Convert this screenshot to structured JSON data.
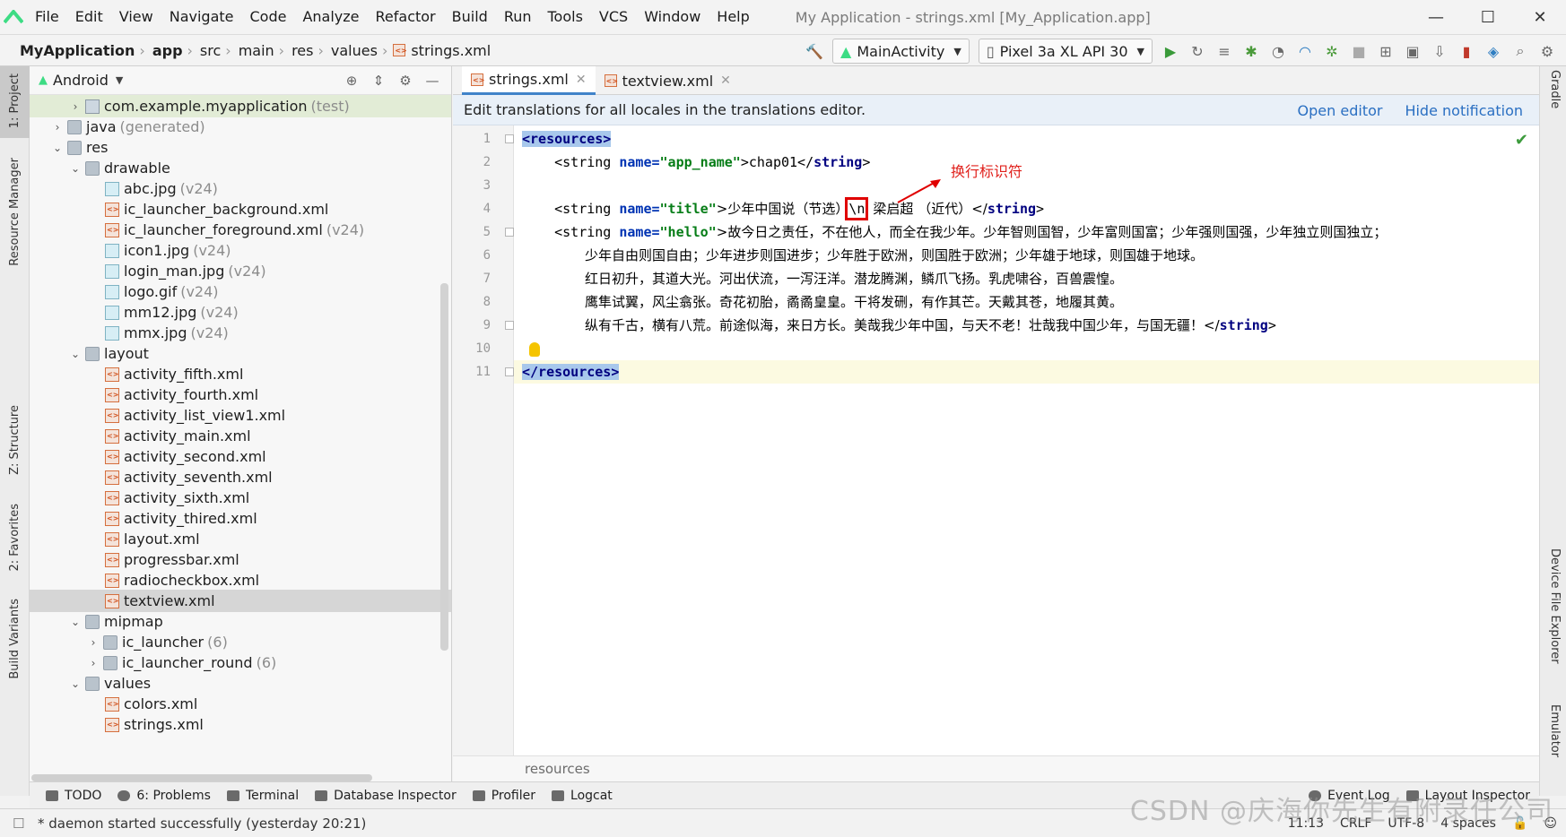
{
  "window": {
    "title": "My Application - strings.xml [My_Application.app]",
    "menu": [
      "File",
      "Edit",
      "View",
      "Navigate",
      "Code",
      "Analyze",
      "Refactor",
      "Build",
      "Run",
      "Tools",
      "VCS",
      "Window",
      "Help"
    ]
  },
  "navbar": {
    "breadcrumbs": [
      "MyApplication",
      "app",
      "src",
      "main",
      "res",
      "values",
      "strings.xml"
    ],
    "run_config": "MainActivity",
    "device": "Pixel 3a XL API 30"
  },
  "left_strip": {
    "tabs": [
      "1: Project",
      "Resource Manager",
      "Z: Structure",
      "2: Favorites",
      "Build Variants"
    ]
  },
  "right_strip": {
    "tabs": [
      "Gradle",
      "Device File Explorer",
      "Emulator"
    ]
  },
  "project": {
    "view": "Android",
    "tree": [
      {
        "label": "com.example.myapplication",
        "suffix": "(test)"
      },
      {
        "label": "java",
        "suffix": "(generated)"
      },
      {
        "label": "res",
        "suffix": ""
      },
      {
        "label": "drawable",
        "suffix": ""
      },
      {
        "label": "abc.jpg",
        "suffix": "(v24)"
      },
      {
        "label": "ic_launcher_background.xml",
        "suffix": ""
      },
      {
        "label": "ic_launcher_foreground.xml",
        "suffix": "(v24)"
      },
      {
        "label": "icon1.jpg",
        "suffix": "(v24)"
      },
      {
        "label": "login_man.jpg",
        "suffix": "(v24)"
      },
      {
        "label": "logo.gif",
        "suffix": "(v24)"
      },
      {
        "label": "mm12.jpg",
        "suffix": "(v24)"
      },
      {
        "label": "mmx.jpg",
        "suffix": "(v24)"
      },
      {
        "label": "layout",
        "suffix": ""
      },
      {
        "label": "activity_fifth.xml",
        "suffix": ""
      },
      {
        "label": "activity_fourth.xml",
        "suffix": ""
      },
      {
        "label": "activity_list_view1.xml",
        "suffix": ""
      },
      {
        "label": "activity_main.xml",
        "suffix": ""
      },
      {
        "label": "activity_second.xml",
        "suffix": ""
      },
      {
        "label": "activity_seventh.xml",
        "suffix": ""
      },
      {
        "label": "activity_sixth.xml",
        "suffix": ""
      },
      {
        "label": "activity_thired.xml",
        "suffix": ""
      },
      {
        "label": "layout.xml",
        "suffix": ""
      },
      {
        "label": "progressbar.xml",
        "suffix": ""
      },
      {
        "label": "radiocheckbox.xml",
        "suffix": ""
      },
      {
        "label": "textview.xml",
        "suffix": ""
      },
      {
        "label": "mipmap",
        "suffix": ""
      },
      {
        "label": "ic_launcher",
        "suffix": "(6)"
      },
      {
        "label": "ic_launcher_round",
        "suffix": "(6)"
      },
      {
        "label": "values",
        "suffix": ""
      },
      {
        "label": "colors.xml",
        "suffix": ""
      },
      {
        "label": "strings.xml",
        "suffix": ""
      }
    ]
  },
  "editor": {
    "tabs": [
      "strings.xml",
      "textview.xml"
    ],
    "notification": "Edit translations for all locales in the translations editor.",
    "notif_open": "Open editor",
    "notif_hide": "Hide notification",
    "line_numbers": [
      "1",
      "2",
      "3",
      "4",
      "5",
      "6",
      "7",
      "8",
      "9",
      "10",
      "11"
    ],
    "annotation": "换行标识符",
    "code": {
      "l1": "<resources>",
      "l2_pre": "    <string ",
      "l2_attr": "name=",
      "l2_val": "\"app_name\"",
      "l2_mid": ">chap01</",
      "l2_tag": "string",
      "l2_end": ">",
      "l4_pre": "    <string ",
      "l4_attr": "name=",
      "l4_val": "\"title\"",
      "l4_text1": ">少年中国说（节选）",
      "l4_nl": "\\n",
      "l4_text2": "梁启超 （近代）</",
      "l4_tag": "string",
      "l4_end": ">",
      "l5_pre": "    <string ",
      "l5_attr": "name=",
      "l5_val": "\"hello\"",
      "l5_text": ">故今日之责任，不在他人，而全在我少年。少年智则国智，少年富则国富；少年强则国强，少年独立则国独立；",
      "l6": "少年自由则国自由；少年进步则国进步；少年胜于欧洲，则国胜于欧洲；少年雄于地球，则国雄于地球。",
      "l7": "红日初升，其道大光。河出伏流，一泻汪洋。潜龙腾渊，鳞爪飞扬。乳虎啸谷，百兽震惶。",
      "l8": "鹰隼试翼，风尘翕张。奇花初胎，矞矞皇皇。干将发硎，有作其芒。天戴其苍，地履其黄。",
      "l9_text": "纵有千古，横有八荒。前途似海，来日方长。美哉我少年中国，与天不老！壮哉我中国少年，与国无疆！</",
      "l9_tag": "string",
      "l9_end": ">",
      "l11": "</resources>"
    },
    "breadcrumb": "resources"
  },
  "bottom_tools": {
    "left": [
      "TODO",
      "6: Problems",
      "Terminal",
      "Database Inspector",
      "Profiler",
      "Logcat"
    ],
    "right": [
      "Event Log",
      "Layout Inspector"
    ]
  },
  "status": {
    "message": "* daemon started successfully (yesterday 20:21)",
    "position": "11:13",
    "line_sep": "CRLF",
    "encoding": "UTF-8",
    "indent": "4 spaces"
  },
  "watermark": "CSDN @庆海你先生有附录任公司"
}
